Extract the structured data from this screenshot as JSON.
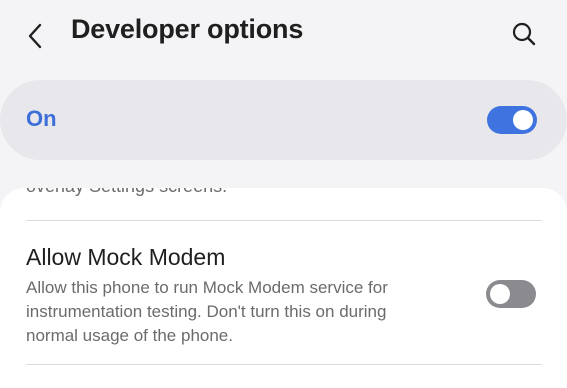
{
  "header": {
    "back_icon": "chevron-left-icon",
    "title": "Developer options",
    "search_icon": "search-icon"
  },
  "master_switch": {
    "label": "On",
    "state": true,
    "accent_color": "#3e73e0"
  },
  "settings": {
    "clipped_previous_text": "overlay Settings screens.",
    "items": [
      {
        "title": "Allow Mock Modem",
        "description_lines": [
          "Allow this phone to run Mock Modem service for",
          "instrumentation testing. Don't turn this on during",
          "normal usage of the phone."
        ],
        "toggle_state": false
      }
    ]
  }
}
